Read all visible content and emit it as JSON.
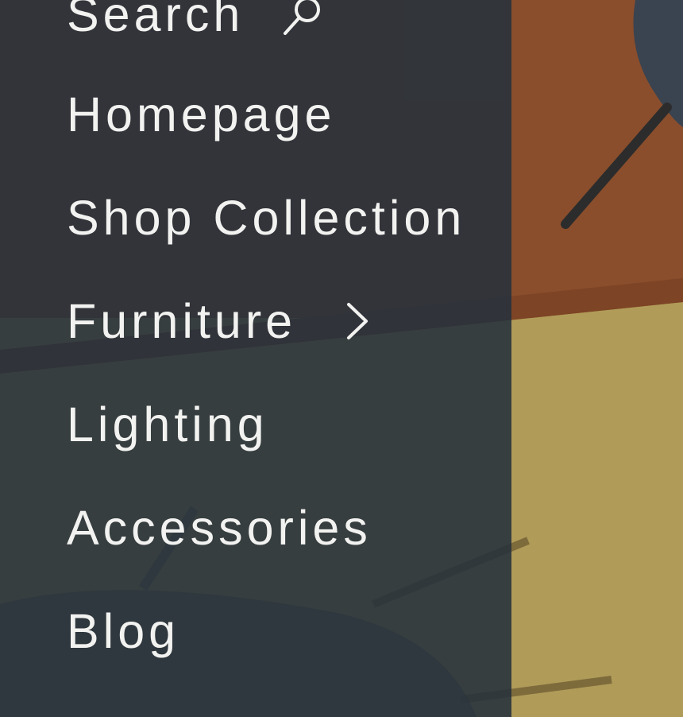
{
  "menu": {
    "items": [
      {
        "label": "Search",
        "icon": "search-icon"
      },
      {
        "label": "Homepage"
      },
      {
        "label": "Shop Collection"
      },
      {
        "label": "Furniture",
        "icon": "chevron-right-icon"
      },
      {
        "label": "Lighting"
      },
      {
        "label": "Accessories"
      },
      {
        "label": "Blog"
      }
    ]
  },
  "colors": {
    "drawer_overlay": "#26313c",
    "menu_text": "#f2f2f0",
    "wall": "#8a4e2c",
    "floor": "#b09c58",
    "chair_fabric": "#3a4350"
  }
}
